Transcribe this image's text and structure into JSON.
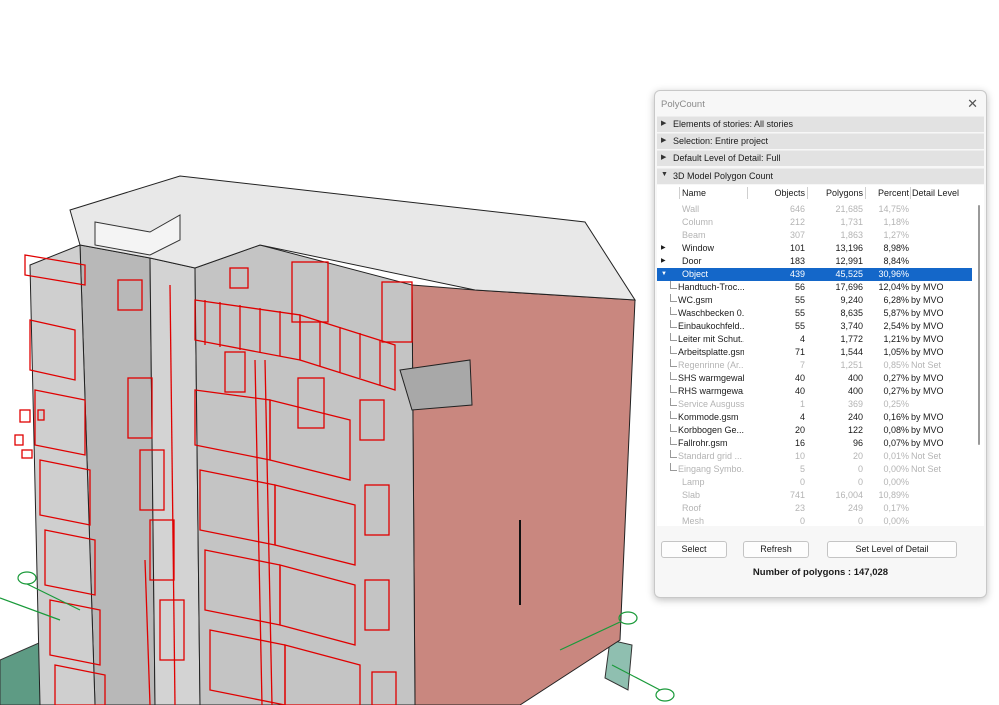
{
  "panel": {
    "title": "PolyCount",
    "sections": [
      {
        "label": "Elements of stories: All stories"
      },
      {
        "label": "Selection: Entire project"
      },
      {
        "label": "Default Level of Detail: Full"
      },
      {
        "label": "3D Model Polygon Count"
      }
    ],
    "columns": [
      "Name",
      "Objects",
      "Polygons",
      "Percent",
      "Detail Level"
    ],
    "rows": [
      {
        "name": "Wall",
        "objects": "646",
        "polygons": "21,685",
        "percent": "14,75%",
        "detail": ""
      },
      {
        "name": "Column",
        "objects": "212",
        "polygons": "1,731",
        "percent": "1,18%",
        "detail": ""
      },
      {
        "name": "Beam",
        "objects": "307",
        "polygons": "1,863",
        "percent": "1,27%",
        "detail": ""
      },
      {
        "name": "Window",
        "objects": "101",
        "polygons": "13,196",
        "percent": "8,98%",
        "detail": ""
      },
      {
        "name": "Door",
        "objects": "183",
        "polygons": "12,991",
        "percent": "8,84%",
        "detail": ""
      },
      {
        "name": "Object",
        "objects": "439",
        "polygons": "45,525",
        "percent": "30,96%",
        "detail": ""
      },
      {
        "name": "Handtuch-Troc...",
        "objects": "56",
        "polygons": "17,696",
        "percent": "12,04%",
        "detail": "by MVO"
      },
      {
        "name": "WC.gsm",
        "objects": "55",
        "polygons": "9,240",
        "percent": "6,28%",
        "detail": "by MVO"
      },
      {
        "name": "Waschbecken 0...",
        "objects": "55",
        "polygons": "8,635",
        "percent": "5,87%",
        "detail": "by MVO"
      },
      {
        "name": "Einbaukochfeld...",
        "objects": "55",
        "polygons": "3,740",
        "percent": "2,54%",
        "detail": "by MVO"
      },
      {
        "name": "Leiter mit Schut...",
        "objects": "4",
        "polygons": "1,772",
        "percent": "1,21%",
        "detail": "by MVO"
      },
      {
        "name": "Arbeitsplatte.gsm",
        "objects": "71",
        "polygons": "1,544",
        "percent": "1,05%",
        "detail": "by MVO"
      },
      {
        "name": "Regenrinne (Ar...",
        "objects": "7",
        "polygons": "1,251",
        "percent": "0,85%",
        "detail": "Not Set"
      },
      {
        "name": "SHS warmgewal...",
        "objects": "40",
        "polygons": "400",
        "percent": "0,27%",
        "detail": "by MVO"
      },
      {
        "name": "RHS warmgewa...",
        "objects": "40",
        "polygons": "400",
        "percent": "0,27%",
        "detail": "by MVO"
      },
      {
        "name": "Service Ausguss...",
        "objects": "1",
        "polygons": "369",
        "percent": "0,25%",
        "detail": ""
      },
      {
        "name": "Kommode.gsm",
        "objects": "4",
        "polygons": "240",
        "percent": "0,16%",
        "detail": "by MVO"
      },
      {
        "name": "Korbbogen Ge...",
        "objects": "20",
        "polygons": "122",
        "percent": "0,08%",
        "detail": "by MVO"
      },
      {
        "name": "Fallrohr.gsm",
        "objects": "16",
        "polygons": "96",
        "percent": "0,07%",
        "detail": "by MVO"
      },
      {
        "name": "Standard grid ...",
        "objects": "10",
        "polygons": "20",
        "percent": "0,01%",
        "detail": "Not Set"
      },
      {
        "name": "Eingang Symbo...",
        "objects": "5",
        "polygons": "0",
        "percent": "0,00%",
        "detail": "Not Set"
      },
      {
        "name": "Lamp",
        "objects": "0",
        "polygons": "0",
        "percent": "0,00%",
        "detail": ""
      },
      {
        "name": "Slab",
        "objects": "741",
        "polygons": "16,004",
        "percent": "10,89%",
        "detail": ""
      },
      {
        "name": "Roof",
        "objects": "23",
        "polygons": "249",
        "percent": "0,17%",
        "detail": ""
      },
      {
        "name": "Mesh",
        "objects": "0",
        "polygons": "0",
        "percent": "0,00%",
        "detail": ""
      }
    ],
    "buttons": {
      "select": "Select",
      "refresh": "Refresh",
      "set_lod": "Set Level of Detail"
    },
    "polygon_count": "Number of polygons : 147,028"
  },
  "colors": {
    "selection": "#1467c9",
    "model_lines": "#e00000",
    "facade": "#c9877f"
  }
}
